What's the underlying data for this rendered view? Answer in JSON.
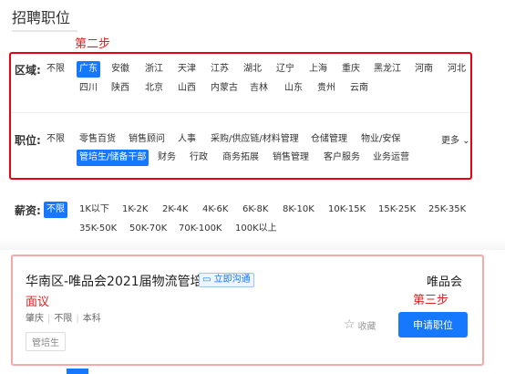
{
  "page_title": "招聘职位",
  "annotations": {
    "step2": "第二步",
    "step3": "第三步",
    "interview": "面议"
  },
  "filters": {
    "region_label": "区域:",
    "region_options": [
      "不限",
      "广东",
      "安徽",
      "浙江",
      "天津",
      "江苏",
      "湖北",
      "辽宁",
      "上海",
      "重庆",
      "黑龙江",
      "河南",
      "河北",
      "四川",
      "陕西",
      "北京",
      "山西",
      "内蒙古",
      "吉林",
      "山东",
      "贵州",
      "云南"
    ],
    "region_selected": "广东",
    "position_label": "职位:",
    "position_options": [
      "不限",
      "零售百货",
      "销售顾问",
      "人事",
      "采购/供应链/材料管理",
      "仓储管理",
      "物业/安保",
      "管培生/储备干部",
      "财务",
      "行政",
      "商务拓展",
      "销售管理",
      "客户服务",
      "业务运营"
    ],
    "position_selected": "管培生/储备干部",
    "more": "更多",
    "salary_label": "薪资:",
    "salary_options": [
      "不限",
      "1K以下",
      "1K-2K",
      "2K-4K",
      "4K-6K",
      "6K-8K",
      "8K-10K",
      "10K-15K",
      "15K-25K",
      "25K-35K",
      "35K-50K",
      "50K-70K",
      "70K-100K",
      "100K以上"
    ],
    "salary_selected": "不限"
  },
  "job": {
    "title": "华南区-唯品会2021届物流管培生",
    "chat_label": "立即沟通",
    "company": "唯品会",
    "location": "肇庆",
    "experience": "不限",
    "education": "本科",
    "tag": "管培生",
    "favorite_label": "收藏",
    "apply_label": "申请职位"
  },
  "colors": {
    "accent": "#1677ff",
    "annotation_red": "#e60012"
  }
}
